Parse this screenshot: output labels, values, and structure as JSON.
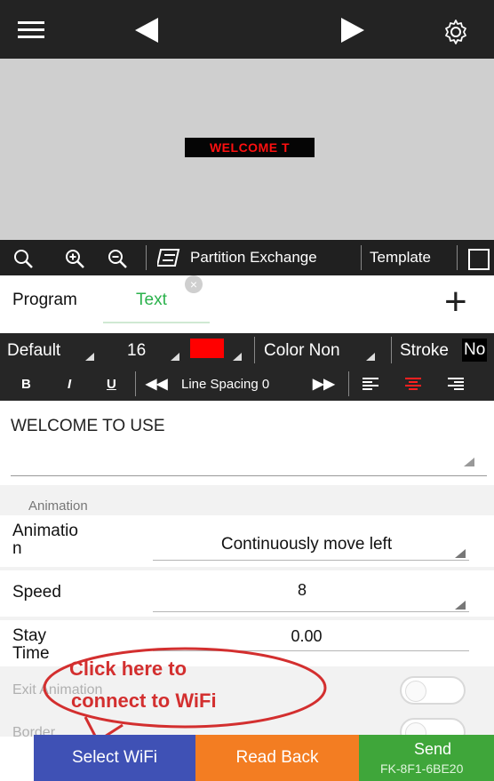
{
  "preview": {
    "led_text": "WELCOME T"
  },
  "toolbar": {
    "partition_exchange": "Partition Exchange",
    "template": "Template"
  },
  "tabs": {
    "program": "Program",
    "text": "Text",
    "add": "+"
  },
  "format": {
    "font": "Default",
    "size": "16",
    "text_color": "#ff0000",
    "color_label": "Color Non",
    "stroke_label": "Stroke",
    "stroke_value": "No",
    "bold": "B",
    "italic": "I",
    "underline": "U",
    "line_spacing": "Line Spacing 0"
  },
  "text_content": "WELCOME TO USE",
  "animation": {
    "section_header": "Animation",
    "animation_label": "Animatio\nn",
    "animation_value": "Continuously move left",
    "speed_label": "Speed",
    "speed_value": "8",
    "stay_label": "Stay\nTime",
    "stay_value": "0.00",
    "exit_label": "Exit Animation",
    "border_label": "Border"
  },
  "callout": {
    "line1": "Click here to",
    "line2": "connect to WiFi"
  },
  "bottom": {
    "select_wifi": "Select WiFi",
    "read_back": "Read Back",
    "send": "Send",
    "device_id": "FK-8F1-6BE20"
  },
  "colors": {
    "accent_green": "#2bb24c",
    "select_blue": "#3f51b5",
    "read_orange": "#f37d22",
    "send_green": "#3fa63a",
    "callout_red": "#d32f2f"
  }
}
